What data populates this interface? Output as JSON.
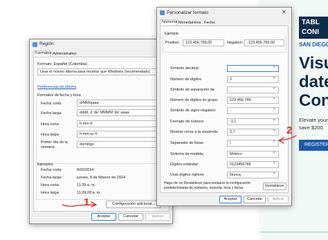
{
  "ad": {
    "banner_line1": "TABL",
    "banner_line2": "CONI",
    "city": "SAN DIEGO",
    "big1": "Visu",
    "big2": "date",
    "big3": "Con",
    "body1": "Elevate your c",
    "body2": "save $200.",
    "register": "REGISTER"
  },
  "region": {
    "title": "Región",
    "tabs": [
      "Formatos",
      "Administrativo"
    ],
    "format_label": "Formato: Español (Colombia)",
    "format_value": "Usar el mismo idioma para mostrar que Windows (recomendado)",
    "language_link": "Preferencias de idioma",
    "date_time_group": "Formatos de fecha y hora",
    "rows": [
      {
        "label": "Fecha corta:",
        "value": "d/MM/aaaa"
      },
      {
        "label": "Fecha larga:",
        "value": "dddd, d 'de' MMMM 'de' aaaa"
      },
      {
        "label": "Hora corta:",
        "value": "h:mm tt"
      },
      {
        "label": "Hora larga:",
        "value": "h:mm:ss tt"
      },
      {
        "label": "Primer día de la semana:",
        "value": "domingo"
      }
    ],
    "examples_group": "Ejemplos",
    "examples": [
      {
        "label": "Fecha corta:",
        "value": "8/02/2024"
      },
      {
        "label": "Fecha larga:",
        "value": "jueves, 8 de febrero de 2024"
      },
      {
        "label": "Hora corta:",
        "value": "11:29 a. m."
      },
      {
        "label": "Hora larga:",
        "value": "11:29:28 a. m."
      }
    ],
    "additional_button": "Configuración adicional...",
    "ok": "Aceptar",
    "cancel": "Cancelar",
    "apply": "Aplicar"
  },
  "custom": {
    "title": "Personalizar formato",
    "tabs": [
      "Números",
      "Moneda",
      "Hora",
      "Fecha"
    ],
    "example_group": "Ejemplo",
    "positive_label": "Positivo:",
    "positive_value": "123.456.789,00",
    "negative_label": "Negativo:",
    "negative_value": "-123.456.789,00",
    "rows": [
      {
        "label": "Símbolo decimal:",
        "value": ""
      },
      {
        "label": "Número de dígitos",
        "value": "2"
      },
      {
        "label": "Símbolo de separación de",
        "value": "."
      },
      {
        "label": "Número de dígitos en grupo:",
        "value": "123.456.789"
      },
      {
        "label": "Símbolo de signo negativo:",
        "value": "-"
      },
      {
        "label": "Formato de número",
        "value": "-1,1"
      },
      {
        "label": "Mostrar ceros a la izquierda:",
        "value": "0,7"
      },
      {
        "label": "Separador de listas:",
        "value": "|"
      },
      {
        "label": "Sistema de medida:",
        "value": "Métrico"
      },
      {
        "label": "Dígitos estándar:",
        "value": "0123456789"
      },
      {
        "label": "Usar dígitos nativos:",
        "value": "Nunca"
      }
    ],
    "reset_text": "Haga clic en Restablecer para restaurar la configuración predeterminada de números, moneda, hora y fecha.",
    "reset_button": "Restablecer",
    "ok": "Aceptar",
    "cancel": "Cancelar",
    "apply": "Aplicar"
  },
  "annotations": {
    "one": "1",
    "two": "2"
  },
  "colors": {
    "arrow": "#d92a2a",
    "link": "#1f5aa6",
    "ad_navy": "#0d2c4a"
  }
}
